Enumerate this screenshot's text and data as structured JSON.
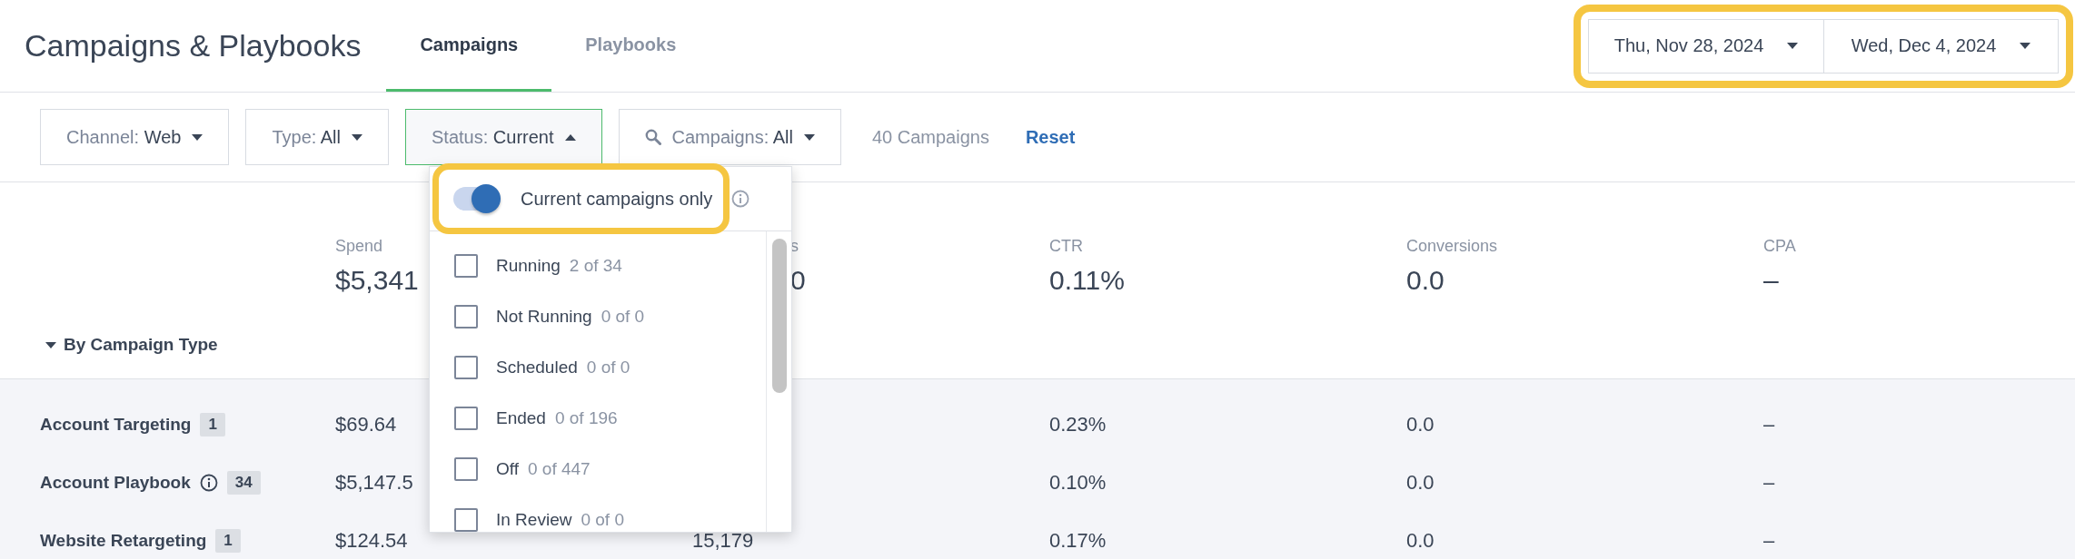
{
  "header": {
    "title": "Campaigns & Playbooks",
    "tabs": [
      {
        "label": "Campaigns",
        "selected": true
      },
      {
        "label": "Playbooks",
        "selected": false
      }
    ],
    "date_range": {
      "highlighted": true,
      "dates": [
        "Thu, Nov 28, 2024",
        "Wed, Dec 4, 2024"
      ]
    }
  },
  "filters": [
    {
      "kind": "plain",
      "label": "Channel:",
      "value": "Web",
      "open": false
    },
    {
      "kind": "plain",
      "label": "Type:",
      "value": "All",
      "open": false
    },
    {
      "kind": "plain",
      "label": "Status:",
      "value": "Current",
      "open": true
    },
    {
      "kind": "search",
      "label": "Campaigns:",
      "value": "All",
      "open": false
    }
  ],
  "campaign_count": "40 Campaigns",
  "reset": "Reset",
  "status_dropdown": {
    "toggle": {
      "label": "Current campaigns only",
      "on": true,
      "highlighted": true
    },
    "options": [
      {
        "label": "Running",
        "count": "2 of 34",
        "checked": false
      },
      {
        "label": "Not Running",
        "count": "0 of 0",
        "checked": false
      },
      {
        "label": "Scheduled",
        "count": "0 of 0",
        "checked": false
      },
      {
        "label": "Ended",
        "count": "0 of 196",
        "checked": false
      },
      {
        "label": "Off",
        "count": "0 of 447",
        "checked": false
      },
      {
        "label": "In Review",
        "count": "0 of 0",
        "checked": false
      }
    ]
  },
  "summary": {
    "metrics": [
      {
        "label": "Spend",
        "value": "$5,341",
        "covered": false
      },
      {
        "label": "s",
        "value": "0",
        "covered": true
      },
      {
        "label": "CTR",
        "value": "0.11%",
        "covered": false
      },
      {
        "label": "Conversions",
        "value": "0.0",
        "covered": false
      },
      {
        "label": "CPA",
        "value": "–",
        "covered": false
      }
    ],
    "group_by": {
      "label": "By Campaign Type",
      "expanded": true
    }
  },
  "rows": [
    {
      "name": "Account Targeting",
      "info": false,
      "count": "1",
      "spend": "$69.64",
      "ctr": "0.23%",
      "conversions": "0.0",
      "cpa": "–"
    },
    {
      "name": "Account Playbook",
      "info": true,
      "count": "34",
      "spend": "$5,147.5",
      "ctr": "0.10%",
      "conversions": "0.0",
      "cpa": "–"
    },
    {
      "name": "Website Retargeting",
      "info": false,
      "count": "1",
      "spend": "$124.54",
      "impressions": "15,179",
      "ctr": "0.17%",
      "conversions": "0.0",
      "cpa": "–"
    }
  ]
}
